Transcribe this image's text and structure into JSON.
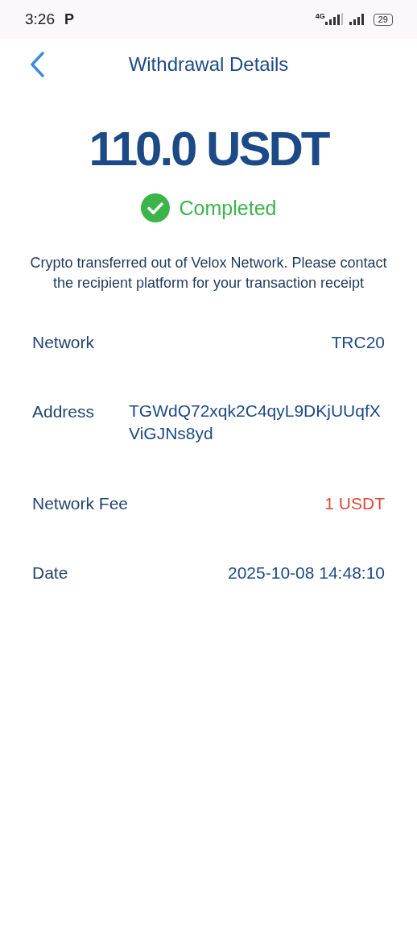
{
  "status_bar": {
    "time": "3:26",
    "notification": "P",
    "network": "4G",
    "battery": "29"
  },
  "header": {
    "title": "Withdrawal Details"
  },
  "amount": "110.0 USDT",
  "status": {
    "label": "Completed",
    "completed": true
  },
  "message": "Crypto transferred out of Velox Network. Please contact the recipient platform for your transaction receipt",
  "details": [
    {
      "label": "Network",
      "value": "TRC20",
      "kind": "short",
      "color": "#1c4a86"
    },
    {
      "label": "Address",
      "value": "TGWdQ72xqk2C4qyL9DKjUUqfXViGJNs8yd",
      "kind": "long",
      "color": "#1c4a86"
    },
    {
      "label": "Network Fee",
      "value": "1 USDT",
      "kind": "short",
      "color": "#dc4a3e"
    },
    {
      "label": "Date",
      "value": "2025-10-08 14:48:10",
      "kind": "short",
      "color": "#1c4a86"
    }
  ]
}
